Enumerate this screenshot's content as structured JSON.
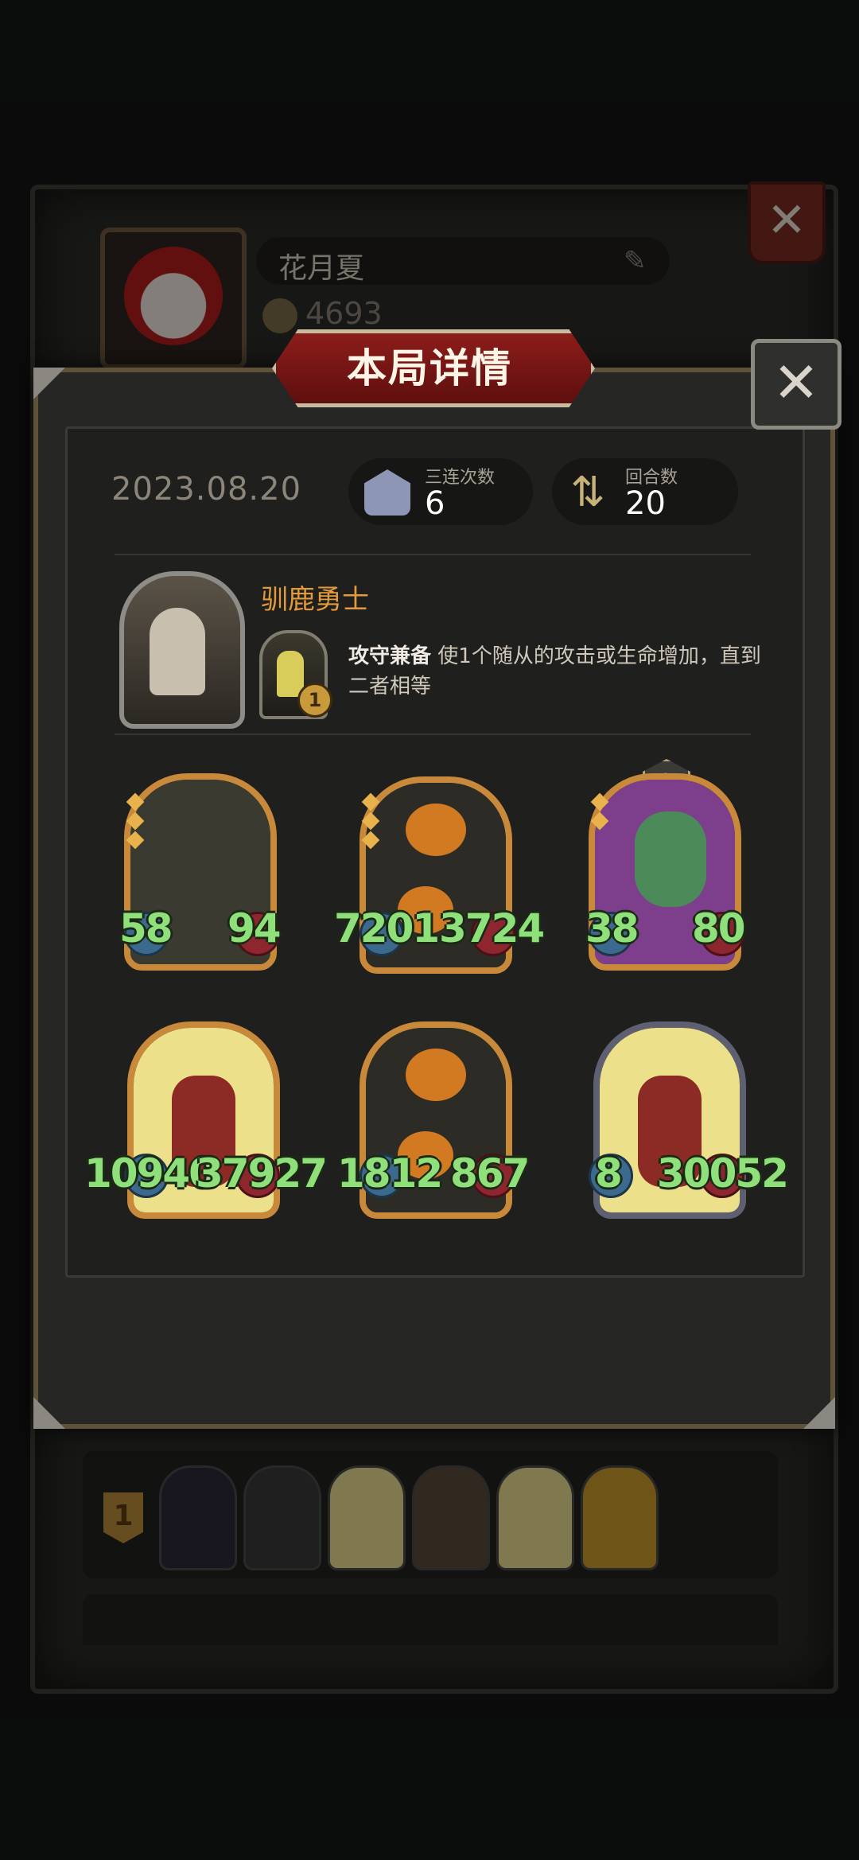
{
  "profile": {
    "player_name": "花月夏",
    "coins": "4693",
    "edit_icon": "pencil-icon",
    "close_icon": "close-icon"
  },
  "popup": {
    "title": "本局详情",
    "close_icon": "close-icon",
    "date": "2023.08.20",
    "stats": [
      {
        "label": "三连次数",
        "value": "6",
        "icon": "triple-stack-icon"
      },
      {
        "label": "回合数",
        "value": "20",
        "icon": "round-cycle-icon"
      }
    ],
    "hero": {
      "name": "驯鹿勇士",
      "skill_name": "攻守兼备",
      "skill_desc": "使1个随从的攻击或生命增加，直到二者相等",
      "skill_level": "1"
    },
    "minions": [
      {
        "name": "rabbit-mask-minion",
        "attack": "58",
        "health": "94",
        "frame": "gold",
        "stars": 3,
        "art_color": "#3a3a30"
      },
      {
        "name": "pumpkin-scarecrow-minion",
        "attack": "7201",
        "health": "3724",
        "frame": "gold",
        "stars": 3,
        "art_color": "#2d2b26"
      },
      {
        "name": "parrot-minion",
        "attack": "38",
        "health": "80",
        "frame": "gold",
        "stars": 2,
        "tier": "2",
        "art_color": "#7d3f8c"
      },
      {
        "name": "dwarf-warrior-minion",
        "attack": "10940",
        "health": "37927",
        "frame": "gold",
        "stars": 0,
        "art_color": "#ede08a"
      },
      {
        "name": "pumpkin-scarecrow-minion",
        "attack": "1812",
        "health": "867",
        "frame": "gold",
        "stars": 0,
        "art_color": "#2d2b26"
      },
      {
        "name": "dwarf-warrior-minion",
        "attack": "8",
        "health": "30052",
        "frame": "silver",
        "stars": 0,
        "art_color": "#ede08a"
      }
    ]
  },
  "history": {
    "rank": "1",
    "cards": [
      "#2c2a3a",
      "#3a3a3a",
      "#e9dd93",
      "#5a4a3a",
      "#e9dd93",
      "#c99a2a"
    ]
  },
  "colors": {
    "accent_orange": "#e39a3c",
    "stat_green": "#8fe07a",
    "banner_red": "#8c1d1b",
    "frame_gold": "#c9893a"
  }
}
